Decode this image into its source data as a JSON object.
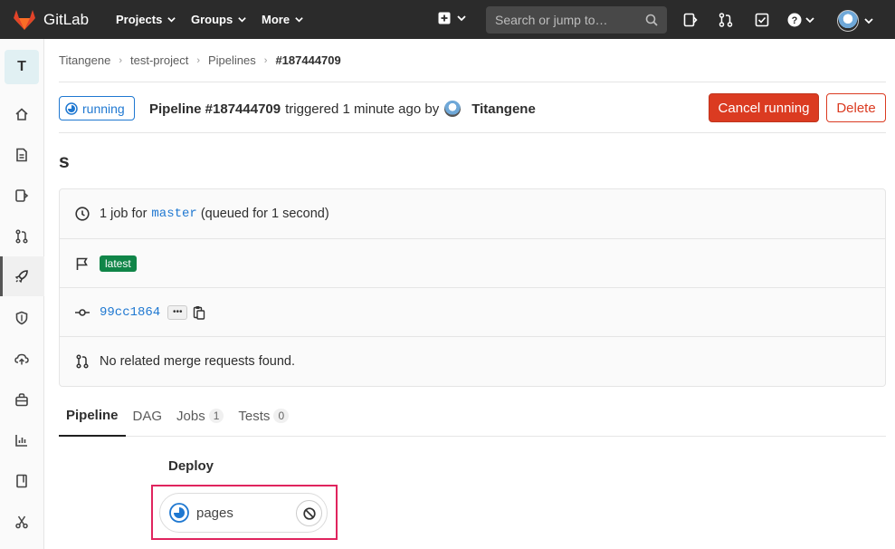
{
  "topbar": {
    "brand": "GitLab",
    "nav": [
      "Projects",
      "Groups",
      "More"
    ],
    "search_placeholder": "Search or jump to…"
  },
  "sidebar": {
    "project_initial": "T",
    "icons": [
      "home-icon",
      "repository-icon",
      "issues-icon",
      "merge-request-icon",
      "rocket-icon",
      "shield-icon",
      "cloud-upload-icon",
      "package-icon",
      "analytics-icon",
      "wiki-icon",
      "snippets-icon"
    ]
  },
  "breadcrumb": [
    "Titangene",
    "test-project",
    "Pipelines",
    "#187444709"
  ],
  "header": {
    "status": "running",
    "pipeline": "Pipeline #187444709",
    "triggered": "triggered 1 minute ago by",
    "user": "Titangene",
    "cancel": "Cancel running",
    "delete": "Delete"
  },
  "title": "s",
  "info": {
    "jobs_prefix": "1 job for",
    "branch": "master",
    "queued": "(queued for 1 second)",
    "tag": "latest",
    "commit": "99cc1864",
    "merge_requests": "No related merge requests found."
  },
  "tabs": [
    {
      "label": "Pipeline"
    },
    {
      "label": "DAG"
    },
    {
      "label": "Jobs",
      "count": "1"
    },
    {
      "label": "Tests",
      "count": "0"
    }
  ],
  "pipeline": {
    "stage": "Deploy",
    "job": "pages"
  },
  "colors": {
    "topbar": "#2b2b2b",
    "running": "#1f78d1",
    "danger": "#db3b21",
    "latest": "#108548",
    "highlight": "#e0245e"
  }
}
